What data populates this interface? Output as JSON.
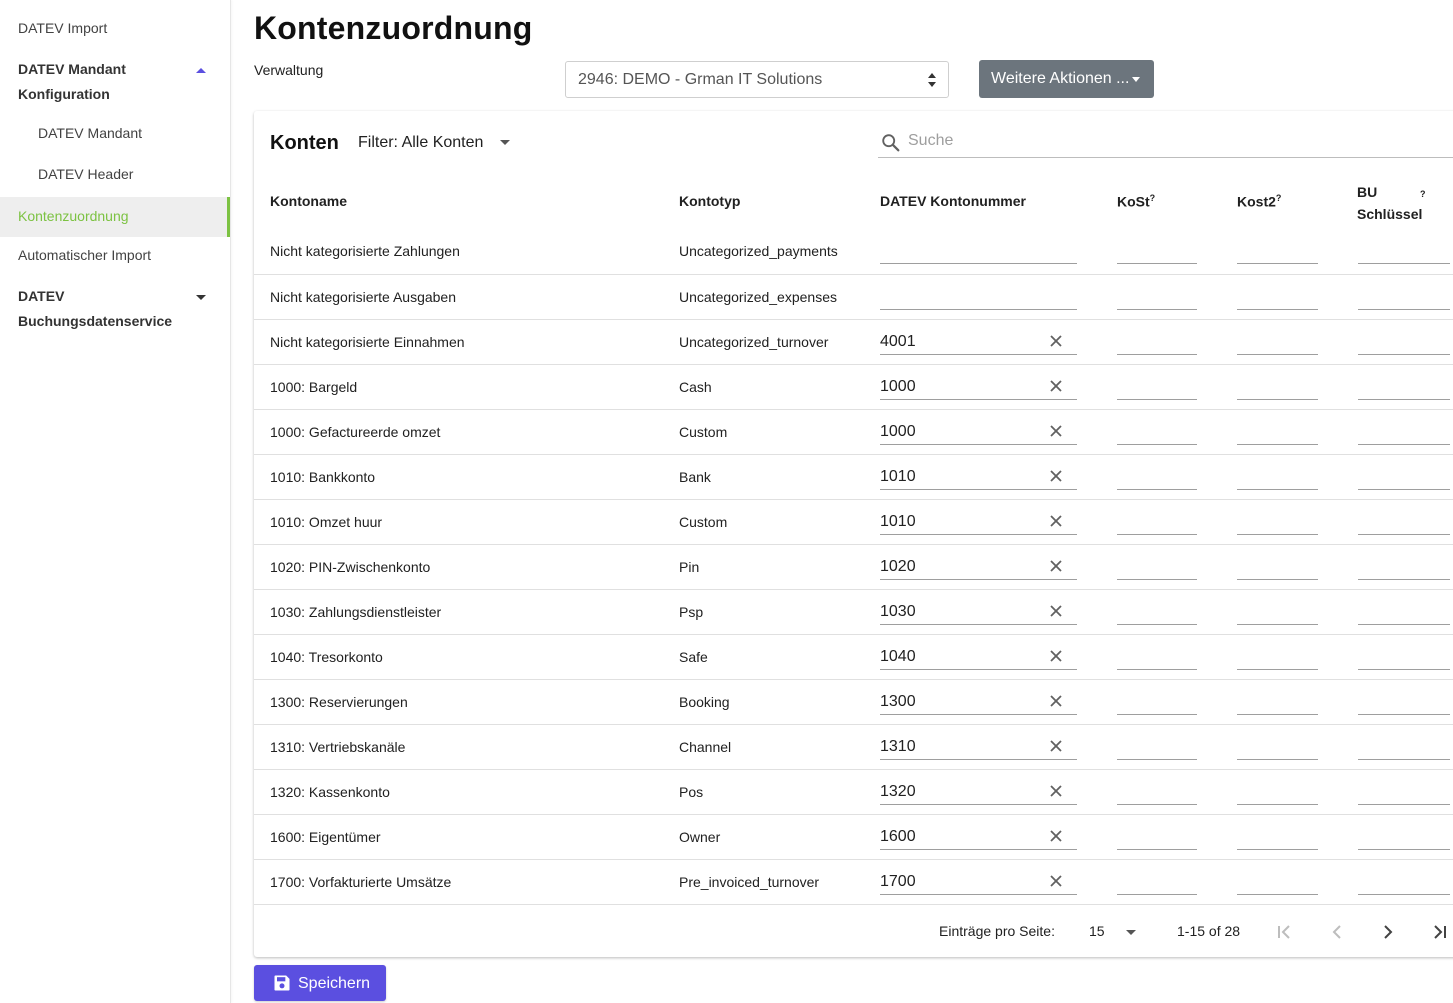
{
  "sidebar": {
    "items": [
      {
        "label": "DATEV Import"
      },
      {
        "label": "DATEV Mandant Konfiguration"
      },
      {
        "label": "DATEV Mandant"
      },
      {
        "label": "DATEV Header"
      },
      {
        "label": "Kontenzuordnung"
      },
      {
        "label": "Automatischer Import"
      },
      {
        "label": "DATEV Buchungsdatenservice"
      }
    ],
    "active_color": "#7cc242"
  },
  "header": {
    "title": "Kontenzuordnung",
    "verwaltung_label": "Verwaltung",
    "selected_verwaltung": "2946: DEMO - Grman IT Solutions",
    "actions_label": "Weitere Aktionen ..."
  },
  "card": {
    "title": "Konten",
    "filter_label": "Filter: Alle Konten",
    "search_placeholder": "Suche",
    "columns": {
      "name": "Kontoname",
      "type": "Kontotyp",
      "number": "DATEV Kontonummer",
      "kost": "KoSt",
      "kost2": "Kost2",
      "bu_line1": "BU",
      "bu_line2": "Schlüssel",
      "help": "?"
    },
    "rows": [
      {
        "name": "Nicht kategorisierte Zahlungen",
        "type": "Uncategorized_payments",
        "number": ""
      },
      {
        "name": "Nicht kategorisierte Ausgaben",
        "type": "Uncategorized_expenses",
        "number": ""
      },
      {
        "name": "Nicht kategorisierte Einnahmen",
        "type": "Uncategorized_turnover",
        "number": "4001"
      },
      {
        "name": "1000: Bargeld",
        "type": "Cash",
        "number": "1000"
      },
      {
        "name": "1000: Gefactureerde omzet",
        "type": "Custom",
        "number": "1000"
      },
      {
        "name": "1010: Bankkonto",
        "type": "Bank",
        "number": "1010"
      },
      {
        "name": "1010: Omzet huur",
        "type": "Custom",
        "number": "1010"
      },
      {
        "name": "1020: PIN-Zwischenkonto",
        "type": "Pin",
        "number": "1020"
      },
      {
        "name": "1030: Zahlungsdienstleister",
        "type": "Psp",
        "number": "1030"
      },
      {
        "name": "1040: Tresorkonto",
        "type": "Safe",
        "number": "1040"
      },
      {
        "name": "1300: Reservierungen",
        "type": "Booking",
        "number": "1300"
      },
      {
        "name": "1310: Vertriebskanäle",
        "type": "Channel",
        "number": "1310"
      },
      {
        "name": "1320: Kassenkonto",
        "type": "Pos",
        "number": "1320"
      },
      {
        "name": "1600: Eigentümer",
        "type": "Owner",
        "number": "1600"
      },
      {
        "name": "1700: Vorfakturierte Umsätze",
        "type": "Pre_invoiced_turnover",
        "number": "1700"
      }
    ],
    "pagination": {
      "per_page_label": "Einträge pro Seite:",
      "per_page_value": "15",
      "range": "1-15 of 28"
    }
  },
  "save_label": "Speichern",
  "colors": {
    "primary": "#5b4fe0",
    "secondary_button": "#6c757d",
    "active_nav": "#7cc242"
  }
}
